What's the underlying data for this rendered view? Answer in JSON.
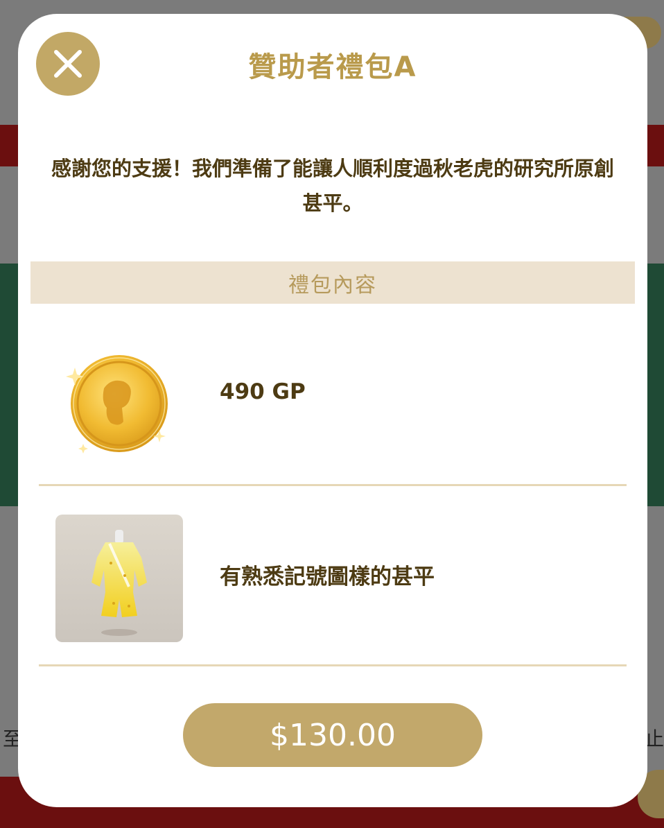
{
  "modal": {
    "title": "贊助者禮包A",
    "description": "感謝您的支援！我們準備了能讓人順利度過秋老虎的研究所原創甚平。",
    "section_header": "禮包內容",
    "items": [
      {
        "label": "490 GP",
        "icon": "gold-coin-icon"
      },
      {
        "label": "有熟悉記號圖樣的甚平",
        "icon": "yellow-jinbei-outfit-image"
      }
    ],
    "price_button": "$130.00",
    "close_icon": "close-icon"
  },
  "background": {
    "left_text": "至",
    "right_text": "止"
  },
  "colors": {
    "accent_gold": "#c2a866",
    "title_gold": "#b99a4b",
    "header_bg": "#ede2d0",
    "text_brown": "#4d3b13",
    "divider": "#e6d7b6"
  }
}
